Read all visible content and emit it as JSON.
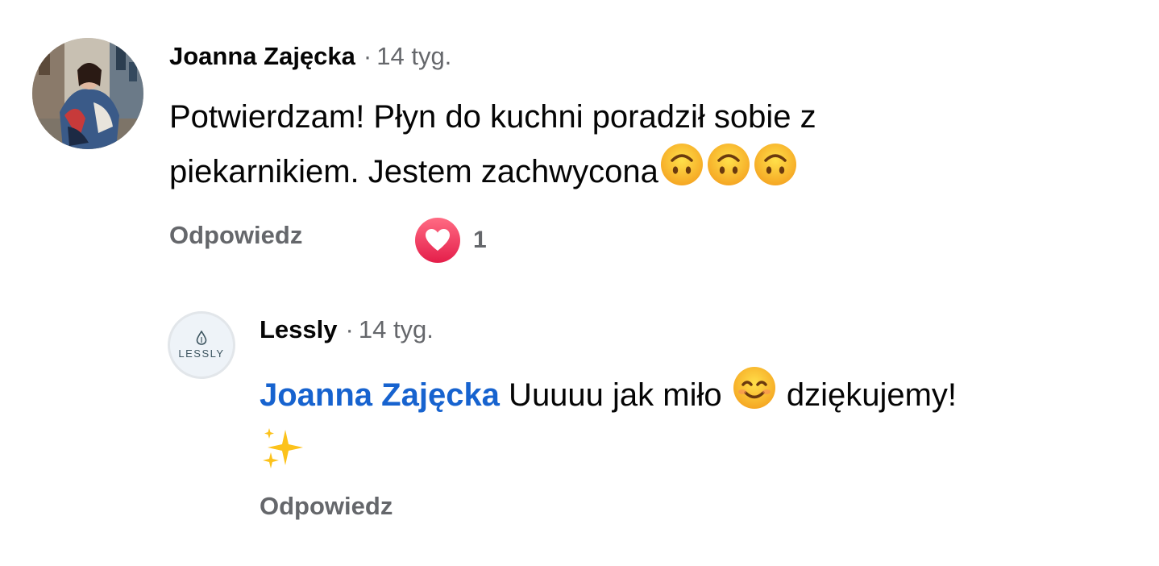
{
  "comment": {
    "author": "Joanna Zajęcka",
    "separator": "·",
    "time": "14 tyg.",
    "text_line1": "Potwierdzam! Płyn do kuchni poradził sobie z",
    "text_line2": "piekarnikiem. Jestem zachwycona",
    "emoji_icons": [
      "upside-down-face-icon",
      "upside-down-face-icon",
      "upside-down-face-icon"
    ],
    "reply_label": "Odpowiedz",
    "reaction": {
      "icon": "heart-icon",
      "count": "1",
      "color": "#e41e4a"
    }
  },
  "reply": {
    "author": "Lessly",
    "separator": "·",
    "time": "14 tyg.",
    "avatar_logo_text": "LESSLY",
    "mention": "Joanna Zajęcka",
    "text_a": " Uuuuu jak miło ",
    "text_b": " dziękujemy!",
    "emoji_icons": [
      "smiling-face-icon",
      "sparkles-icon"
    ],
    "reply_label": "Odpowiedz"
  },
  "colors": {
    "text": "#050505",
    "secondary": "#65676b",
    "mention": "#1763cf"
  }
}
